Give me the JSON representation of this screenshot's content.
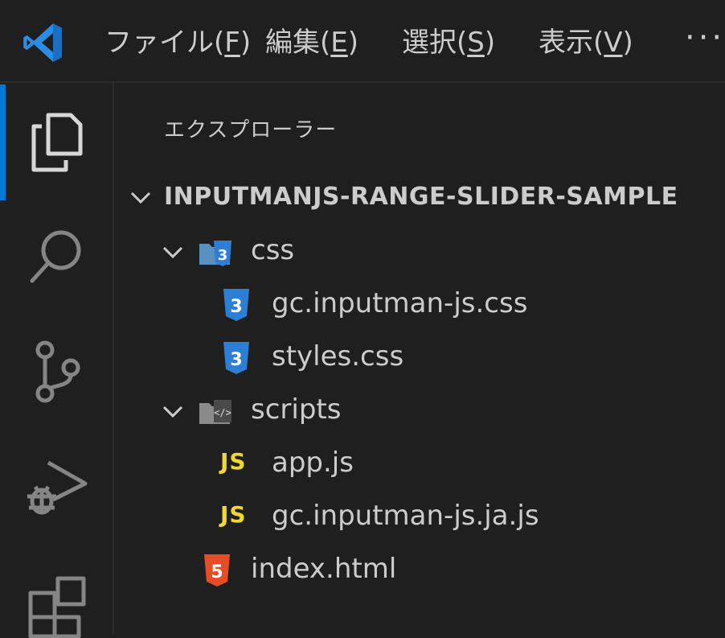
{
  "titlebar": {
    "menus": [
      {
        "label": "ファイル(",
        "mnemonic": "F",
        "close": ")"
      },
      {
        "label": "編集(",
        "mnemonic": "E",
        "close": ")"
      },
      {
        "label": "選択(",
        "mnemonic": "S",
        "close": ")"
      },
      {
        "label": "表示(",
        "mnemonic": "V",
        "close": ")"
      }
    ],
    "more": "···"
  },
  "colors": {
    "background": "#1f1f1f",
    "accent": "#0078d4",
    "text": "#cccccc",
    "js": "#f1d732",
    "css": "#42a5f5",
    "html": "#e44d26"
  },
  "activity": {
    "items": [
      "explorer-icon",
      "search-icon",
      "source-control-icon",
      "run-debug-icon",
      "extensions-icon"
    ]
  },
  "explorer": {
    "title": "エクスプローラー",
    "root": "INPUTMANJS-RANGE-SLIDER-SAMPLE",
    "tree": [
      {
        "name": "css",
        "type": "folder",
        "icon": "css-folder-icon"
      },
      {
        "name": "gc.inputman-js.css",
        "type": "file",
        "icon": "css-file-icon"
      },
      {
        "name": "styles.css",
        "type": "file",
        "icon": "css-file-icon"
      },
      {
        "name": "scripts",
        "type": "folder",
        "icon": "scripts-folder-icon"
      },
      {
        "name": "app.js",
        "type": "file",
        "icon": "js-file-icon",
        "badge": "JS"
      },
      {
        "name": "gc.inputman-js.ja.js",
        "type": "file",
        "icon": "js-file-icon",
        "badge": "JS"
      },
      {
        "name": "index.html",
        "type": "file",
        "icon": "html-file-icon"
      }
    ]
  }
}
